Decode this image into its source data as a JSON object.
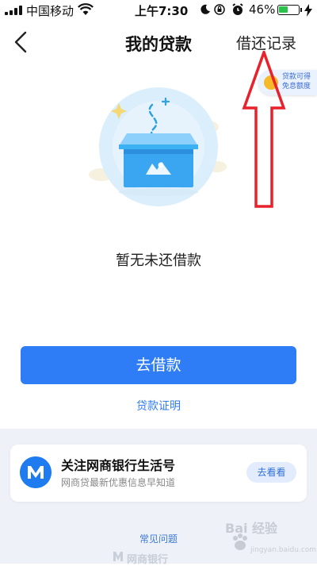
{
  "status_bar": {
    "carrier": "中国移动",
    "time": "上午7:30",
    "battery": "46%"
  },
  "nav": {
    "title": "我的贷款",
    "history_link": "借还记录"
  },
  "promo": {
    "line1": "贷款可得",
    "line2": "免息额度"
  },
  "empty_state": {
    "message": "暂无未还借款"
  },
  "actions": {
    "borrow_button": "去借款",
    "loan_certificate_link": "贷款证明"
  },
  "follow_card": {
    "title": "关注网商银行生活号",
    "subtitle": "网商贷最新优惠信息早知道",
    "button": "去看看"
  },
  "footer": {
    "faq_link": "常见问题",
    "brand": "网商银行"
  },
  "watermark": {
    "brand": "Bai 经验",
    "url": "jingyan.baidu.com"
  },
  "colors": {
    "accent": "#2f7df6",
    "annotation_red": "#e8212b",
    "panel_bg": "#eef2f8"
  }
}
